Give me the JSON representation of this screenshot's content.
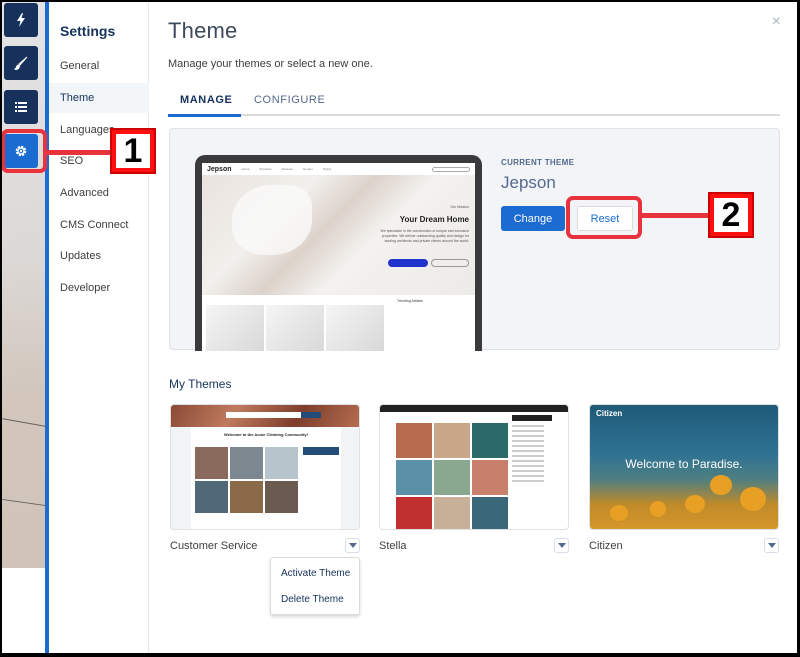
{
  "rail": {
    "items": [
      {
        "name": "lightning-icon",
        "active": false
      },
      {
        "name": "brush-icon",
        "active": false
      },
      {
        "name": "list-icon",
        "active": false
      },
      {
        "name": "gear-icon",
        "active": true
      }
    ]
  },
  "settings_nav": {
    "title": "Settings",
    "items": [
      {
        "label": "General"
      },
      {
        "label": "Theme",
        "active": true
      },
      {
        "label": "Languages"
      },
      {
        "label": "SEO"
      },
      {
        "label": "Advanced"
      },
      {
        "label": "CMS Connect"
      },
      {
        "label": "Updates"
      },
      {
        "label": "Developer"
      }
    ]
  },
  "main": {
    "title": "Theme",
    "description": "Manage your themes or select a new one.",
    "close_icon": "×",
    "tabs": [
      {
        "label": "MANAGE",
        "active": true
      },
      {
        "label": "CONFIGURE",
        "active": false
      }
    ],
    "current_theme": {
      "label": "CURRENT THEME",
      "name": "Jepson",
      "change_label": "Change",
      "reset_label": "Reset",
      "preview": {
        "logo": "Jepson",
        "nav": [
          "Home",
          "Products",
          "Services",
          "Groups",
          "Topics"
        ],
        "mission": "Our Mission",
        "headline": "Your Dream Home",
        "copy": "We specialize in the construction of unique and exclusive properties. We deliver outstanding quality and design for leading architects and private clients around the world.",
        "trending_title": "Trending Articles"
      }
    },
    "my_themes": {
      "title": "My Themes",
      "items": [
        {
          "name": "Customer Service",
          "preview_headline": "Welcome to the Acme Climbing Community!"
        },
        {
          "name": "Stella"
        },
        {
          "name": "Citizen",
          "preview_logo": "Citizen",
          "preview_headline": "Welcome to Paradise."
        }
      ]
    },
    "dropdown": {
      "items": [
        {
          "label": "Activate Theme"
        },
        {
          "label": "Delete Theme"
        }
      ]
    }
  },
  "annotations": {
    "callout_1": "1",
    "callout_2": "2",
    "color": "#e8323c"
  },
  "colors": {
    "brand_blue": "#1b6bd0",
    "rail_dark": "#16325c"
  }
}
